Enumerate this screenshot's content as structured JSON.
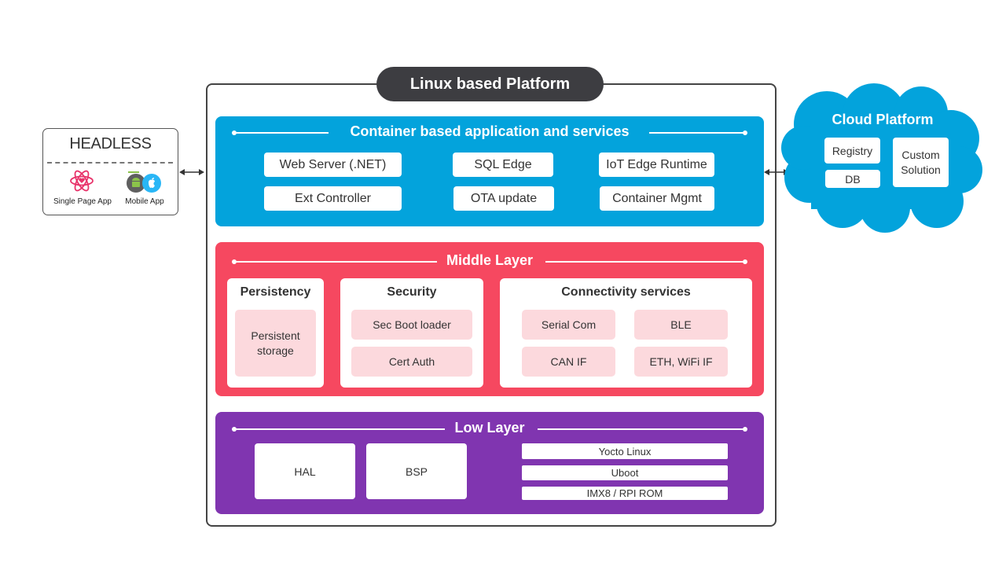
{
  "headless": {
    "title": "HEADLESS",
    "items": [
      {
        "label": "Single Page App",
        "icon": "react-atom-icon"
      },
      {
        "label": "Mobile App",
        "icon": "android-ios-icon"
      }
    ]
  },
  "platform": {
    "title": "Linux based Platform",
    "layers": {
      "container": {
        "title": "Container based application and services",
        "color": "#03a3dc",
        "items": [
          "Web Server (.NET)",
          "SQL Edge",
          "IoT Edge Runtime",
          "Ext Controller",
          "OTA update",
          "Container Mgmt"
        ]
      },
      "middle": {
        "title": "Middle Layer",
        "color": "#f64860",
        "panels": [
          {
            "title": "Persistency",
            "items": [
              "Persistent storage"
            ]
          },
          {
            "title": "Security",
            "items": [
              "Sec Boot loader",
              "Cert Auth"
            ]
          },
          {
            "title": "Connectivity services",
            "items": [
              "Serial Com",
              "BLE",
              "CAN IF",
              "ETH, WiFi IF"
            ]
          }
        ]
      },
      "low": {
        "title": "Low Layer",
        "color": "#8035b0",
        "blocks": [
          "HAL",
          "BSP"
        ],
        "stack": [
          "Yocto Linux",
          "Uboot",
          "IMX8 / RPI ROM"
        ]
      }
    }
  },
  "cloud": {
    "title": "Cloud Platform",
    "color": "#03a3dc",
    "items": [
      "Registry",
      "DB",
      "Custom Solution"
    ]
  },
  "connectors": [
    "headless-to-platform",
    "platform-to-cloud"
  ]
}
